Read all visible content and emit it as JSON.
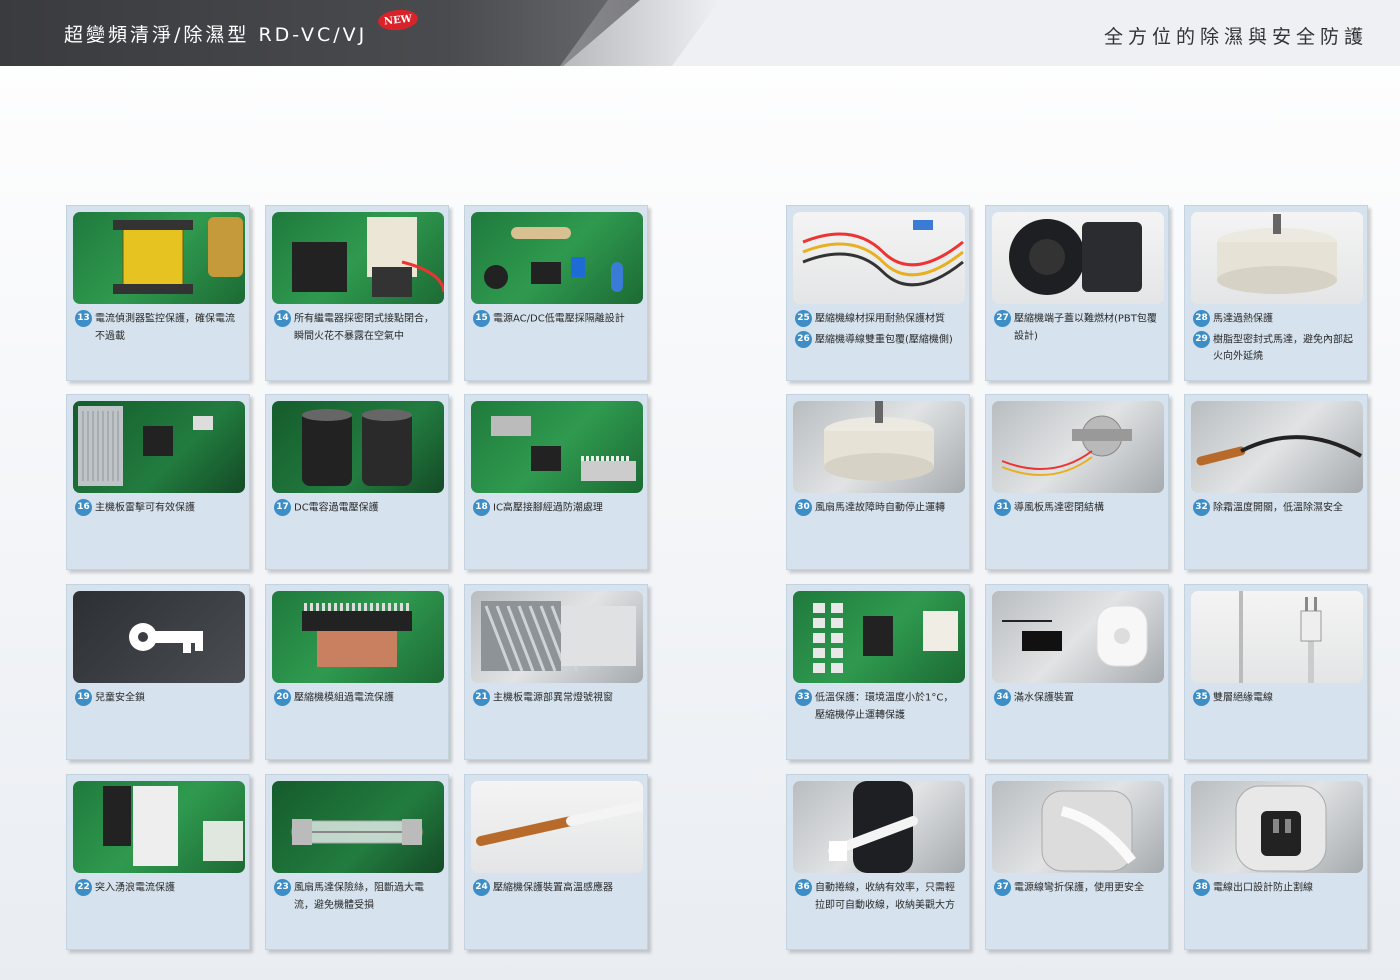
{
  "header": {
    "title_left": "超變頻清淨/除濕型 RD-VC/VJ",
    "badge": "NEW",
    "title_right": "全方位的除濕與安全防護"
  },
  "cards": [
    {
      "icon": "current-sensor-icon",
      "theme": "pcb",
      "lines": [
        {
          "num": "13",
          "text": "電流偵測器監控保護，確保電流不過載"
        }
      ]
    },
    {
      "icon": "relay-icon",
      "theme": "pcb",
      "lines": [
        {
          "num": "14",
          "text": "所有繼電器採密閉式接點閉合，瞬間火花不暴露在空氣中"
        }
      ]
    },
    {
      "icon": "power-isolation-icon",
      "theme": "pcb",
      "lines": [
        {
          "num": "15",
          "text": "電源AC/DC低電壓採隔離設計"
        }
      ]
    },
    {
      "icon": "mainboard-icon",
      "theme": "pcb-dark",
      "lines": [
        {
          "num": "16",
          "text": "主機板雷擊可有效保護"
        }
      ]
    },
    {
      "icon": "capacitor-icon",
      "theme": "pcb-dark",
      "lines": [
        {
          "num": "17",
          "text": "DC電容過電壓保護"
        }
      ]
    },
    {
      "icon": "ic-pin-icon",
      "theme": "pcb",
      "lines": [
        {
          "num": "18",
          "text": "IC高壓接腳經過防潮處理"
        }
      ]
    },
    {
      "icon": "child-lock-icon",
      "theme": "dark",
      "lines": [
        {
          "num": "19",
          "text": "兒童安全鎖"
        }
      ]
    },
    {
      "icon": "compressor-module-icon",
      "theme": "pcb",
      "lines": [
        {
          "num": "20",
          "text": "壓縮機模組過電流保護"
        }
      ]
    },
    {
      "icon": "power-indicator-icon",
      "theme": "gray",
      "lines": [
        {
          "num": "21",
          "text": "主機板電源部異常燈號視窗"
        }
      ]
    },
    {
      "icon": "surge-icon",
      "theme": "pcb",
      "lines": [
        {
          "num": "22",
          "text": "突入湧浪電流保護"
        }
      ]
    },
    {
      "icon": "fuse-icon",
      "theme": "pcb-dark",
      "lines": [
        {
          "num": "23",
          "text": "風扇馬達保險絲，阻斷過大電流，避免機體受損"
        }
      ]
    },
    {
      "icon": "temperature-sensor-icon",
      "theme": "white",
      "lines": [
        {
          "num": "24",
          "text": "壓縮機保護裝置高溫感應器"
        }
      ]
    },
    {
      "icon": "wire-icon",
      "theme": "white",
      "lines": [
        {
          "num": "25",
          "text": "壓縮機線材採用耐熱保護材質"
        },
        {
          "num": "26",
          "text": "壓縮機導線雙重包覆(壓縮機側)"
        }
      ]
    },
    {
      "icon": "terminal-cover-icon",
      "theme": "white",
      "lines": [
        {
          "num": "27",
          "text": "壓縮機端子蓋以難燃材(PBT包覆設計)"
        }
      ]
    },
    {
      "icon": "motor-icon",
      "theme": "white",
      "lines": [
        {
          "num": "28",
          "text": "馬達過熱保護"
        },
        {
          "num": "29",
          "text": "樹脂型密封式馬達，避免內部起火向外延燒"
        }
      ]
    },
    {
      "icon": "fan-motor-icon",
      "theme": "gray",
      "lines": [
        {
          "num": "30",
          "text": "風扇馬達故障時自動停止運轉"
        }
      ]
    },
    {
      "icon": "louver-motor-icon",
      "theme": "gray",
      "lines": [
        {
          "num": "31",
          "text": "導風板馬達密閉結構"
        }
      ]
    },
    {
      "icon": "defrost-sensor-icon",
      "theme": "gray",
      "lines": [
        {
          "num": "32",
          "text": "除霜溫度開關，低溫除濕安全"
        }
      ]
    },
    {
      "icon": "low-temp-icon",
      "theme": "pcb",
      "lines": [
        {
          "num": "33",
          "text": "低溫保護：環境溫度小於1°C，壓縮機停止運轉保護"
        }
      ]
    },
    {
      "icon": "water-full-icon",
      "theme": "gray",
      "lines": [
        {
          "num": "34",
          "text": "滿水保護裝置"
        }
      ]
    },
    {
      "icon": "double-insulated-cord-icon",
      "theme": "white",
      "lines": [
        {
          "num": "35",
          "text": "雙層絕緣電線"
        }
      ]
    },
    {
      "icon": "cord-reel-icon",
      "theme": "gray",
      "lines": [
        {
          "num": "36",
          "text": "自動捲線，收納有效率，只需輕拉即可自動收線，收納美觀大方"
        }
      ]
    },
    {
      "icon": "cord-bend-icon",
      "theme": "gray",
      "lines": [
        {
          "num": "37",
          "text": "電源線彎折保護，使用更安全"
        }
      ]
    },
    {
      "icon": "cord-outlet-icon",
      "theme": "gray",
      "lines": [
        {
          "num": "38",
          "text": "電線出口設計防止割線"
        }
      ]
    }
  ]
}
